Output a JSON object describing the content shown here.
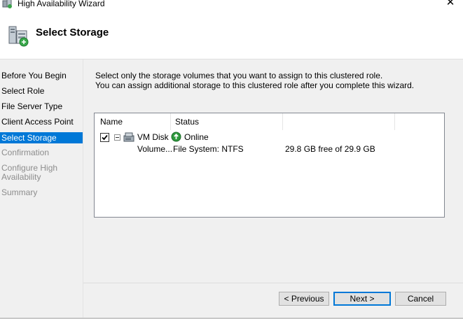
{
  "window": {
    "title": "High Availability Wizard",
    "close_glyph": "✕"
  },
  "header": {
    "title": "Select Storage",
    "icon": "storage-wizard-icon"
  },
  "nav": {
    "items": [
      {
        "label": "Before You Begin",
        "state": "normal"
      },
      {
        "label": "Select Role",
        "state": "normal"
      },
      {
        "label": "File Server Type",
        "state": "normal"
      },
      {
        "label": "Client Access Point",
        "state": "normal"
      },
      {
        "label": "Select Storage",
        "state": "selected"
      },
      {
        "label": "Confirmation",
        "state": "disabled"
      },
      {
        "label": "Configure High\nAvailability",
        "state": "disabled"
      },
      {
        "label": "Summary",
        "state": "disabled"
      }
    ]
  },
  "content": {
    "instruction_line1": "Select only the storage volumes that you want to assign to this clustered role.",
    "instruction_line2": "You can assign additional storage to this clustered role after you complete this wizard."
  },
  "storage_list": {
    "columns": [
      "Name",
      "Status"
    ],
    "disk": {
      "checked": true,
      "name": "VM Disk",
      "status": "Online",
      "volume": {
        "name": "Volume...",
        "filesystem": "File System: NTFS",
        "free": "29.8 GB free of 29.9 GB"
      }
    }
  },
  "buttons": {
    "previous": "< Previous",
    "next": "Next >",
    "cancel": "Cancel"
  },
  "colors": {
    "selection": "#0078d7",
    "panel": "#f0f0f0",
    "online_green": "#2e9a3e"
  }
}
